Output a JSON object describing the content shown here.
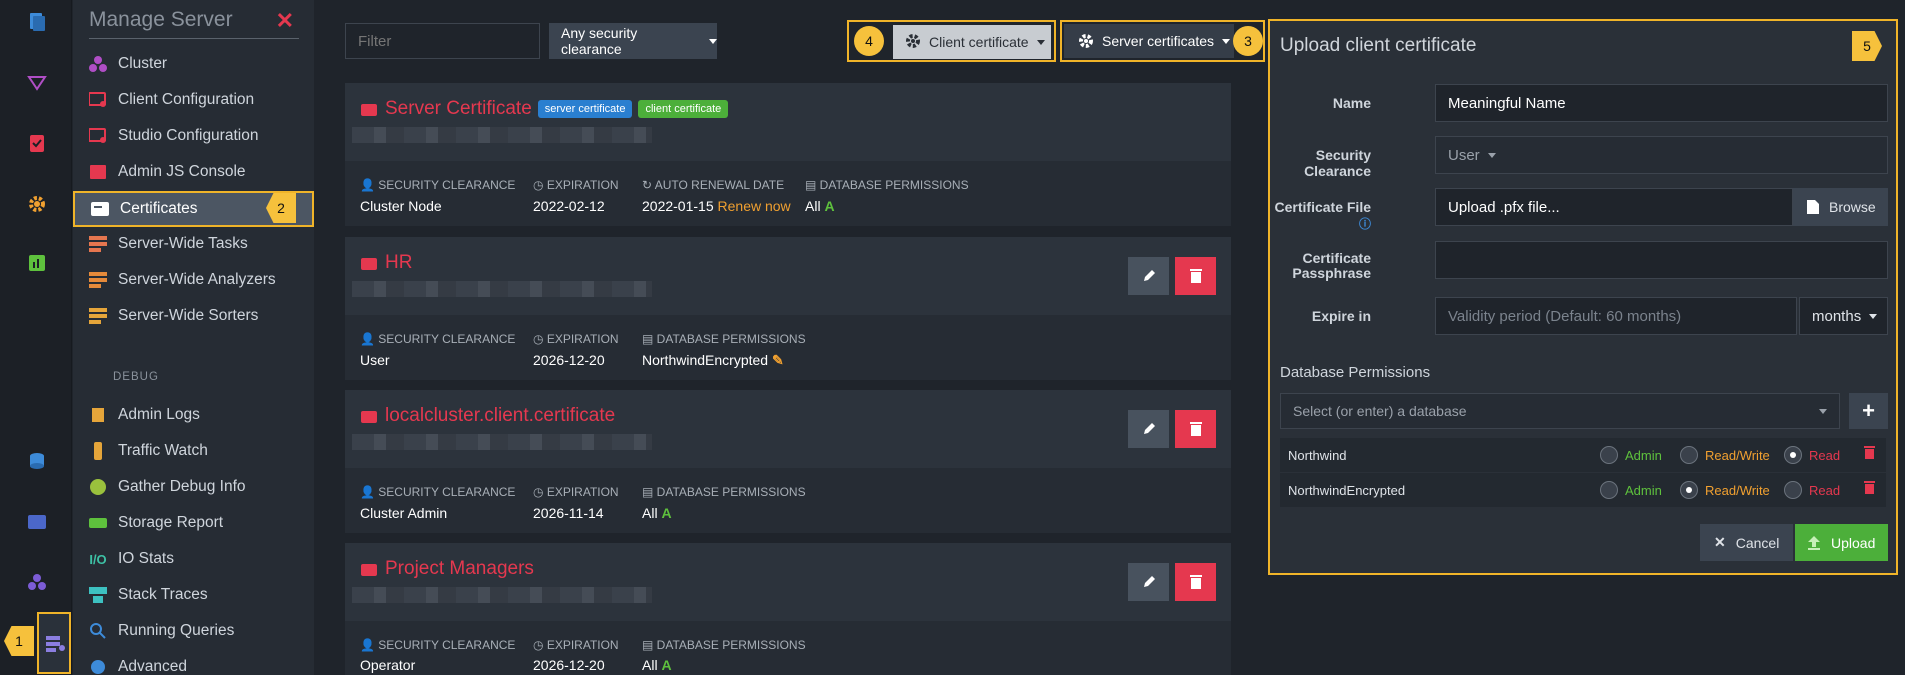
{
  "menu": {
    "title": "Manage Server",
    "debug_label": "DEBUG",
    "items": [
      {
        "label": "Cluster"
      },
      {
        "label": "Client Configuration"
      },
      {
        "label": "Studio Configuration"
      },
      {
        "label": "Admin JS Console"
      },
      {
        "label": "Certificates"
      },
      {
        "label": "Server-Wide Tasks"
      },
      {
        "label": "Server-Wide Analyzers"
      },
      {
        "label": "Server-Wide Sorters"
      }
    ],
    "debug_items": [
      {
        "label": "Admin Logs"
      },
      {
        "label": "Traffic Watch"
      },
      {
        "label": "Gather Debug Info"
      },
      {
        "label": "Storage Report"
      },
      {
        "label": "IO Stats"
      },
      {
        "label": "Stack Traces"
      },
      {
        "label": "Running Queries"
      },
      {
        "label": "Advanced"
      }
    ]
  },
  "badges": {
    "b1": "1",
    "b2": "2",
    "b3": "3",
    "b4": "4",
    "b5": "5"
  },
  "toolbar": {
    "filter_placeholder": "Filter",
    "security_clearance": "Any security clearance",
    "client_certificate": "Client certificate",
    "server_certificates": "Server certificates"
  },
  "labels": {
    "security_clearance": "SECURITY CLEARANCE",
    "expiration": "EXPIRATION",
    "auto_renewal": "AUTO RENEWAL DATE",
    "db_permissions": "DATABASE PERMISSIONS"
  },
  "cards": [
    {
      "name": "Server Certificate",
      "tag1": "server certificate",
      "tag2": "client certificate",
      "clearance": "Cluster Node",
      "expiration": "2022-02-12",
      "renewal": "2022-01-15",
      "renew_now": "Renew now",
      "permissions": "All"
    },
    {
      "name": "HR",
      "clearance": "User",
      "expiration": "2026-12-20",
      "permissions": "NorthwindEncrypted"
    },
    {
      "name": "localcluster.client.certificate",
      "clearance": "Cluster Admin",
      "expiration": "2026-11-14",
      "permissions": "All"
    },
    {
      "name": "Project Managers",
      "clearance": "Operator",
      "expiration": "2026-12-20",
      "permissions": "All"
    }
  ],
  "upload": {
    "title": "Upload client certificate",
    "name_label": "Name",
    "name_value": "Meaningful Name",
    "clearance_label": "Security Clearance",
    "clearance_value": "User",
    "file_label": "Certificate File",
    "file_value": "Upload .pfx file...",
    "browse": "Browse",
    "pass_label1": "Certificate",
    "pass_label2": "Passphrase",
    "expire_label": "Expire in",
    "expire_placeholder": "Validity period (Default: 60 months)",
    "expire_unit": "months",
    "db_perm_title": "Database Permissions",
    "db_placeholder": "Select (or enter) a database",
    "role_admin": "Admin",
    "role_rw": "Read/Write",
    "role_read": "Read",
    "rows": [
      {
        "db": "Northwind",
        "selected": "Read"
      },
      {
        "db": "NorthwindEncrypted",
        "selected": "Read/Write"
      }
    ],
    "cancel": "Cancel",
    "upload": "Upload"
  },
  "colors": {
    "accent": "#f0b429",
    "danger": "#e5384f",
    "success": "#5ec13d"
  }
}
